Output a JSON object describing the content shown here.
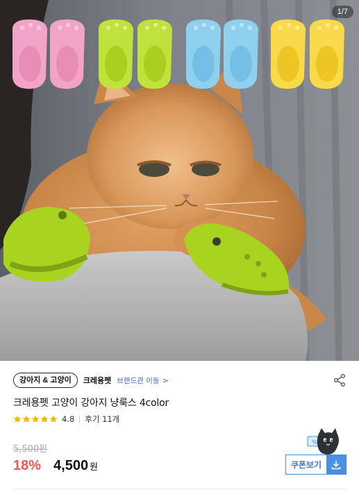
{
  "hero": {
    "image_counter": "1/7",
    "description_icon": "product-photo"
  },
  "brand": {
    "category_chip": "강아지 & 고양이",
    "name": "크레용펫",
    "store_link": "브랜드관 이동",
    "store_link_chevron": ">"
  },
  "product": {
    "title": "크레용펫 고양이 강아지 냥룩스 4color",
    "rating": "4.8",
    "rating_stars": 5,
    "reviews": "후기 11개",
    "original_price": "5,500원",
    "discount": "18%",
    "price": "4,500",
    "price_unit": "원"
  },
  "coupon": {
    "label": "쿠폰보기",
    "icon": "download-icon"
  },
  "colors": {
    "discount": "#f0574b",
    "link": "#4a69c4",
    "coupon_border": "#4a8bd6",
    "coupon_fill": "#4a8fe0",
    "star": "#f5b800"
  }
}
